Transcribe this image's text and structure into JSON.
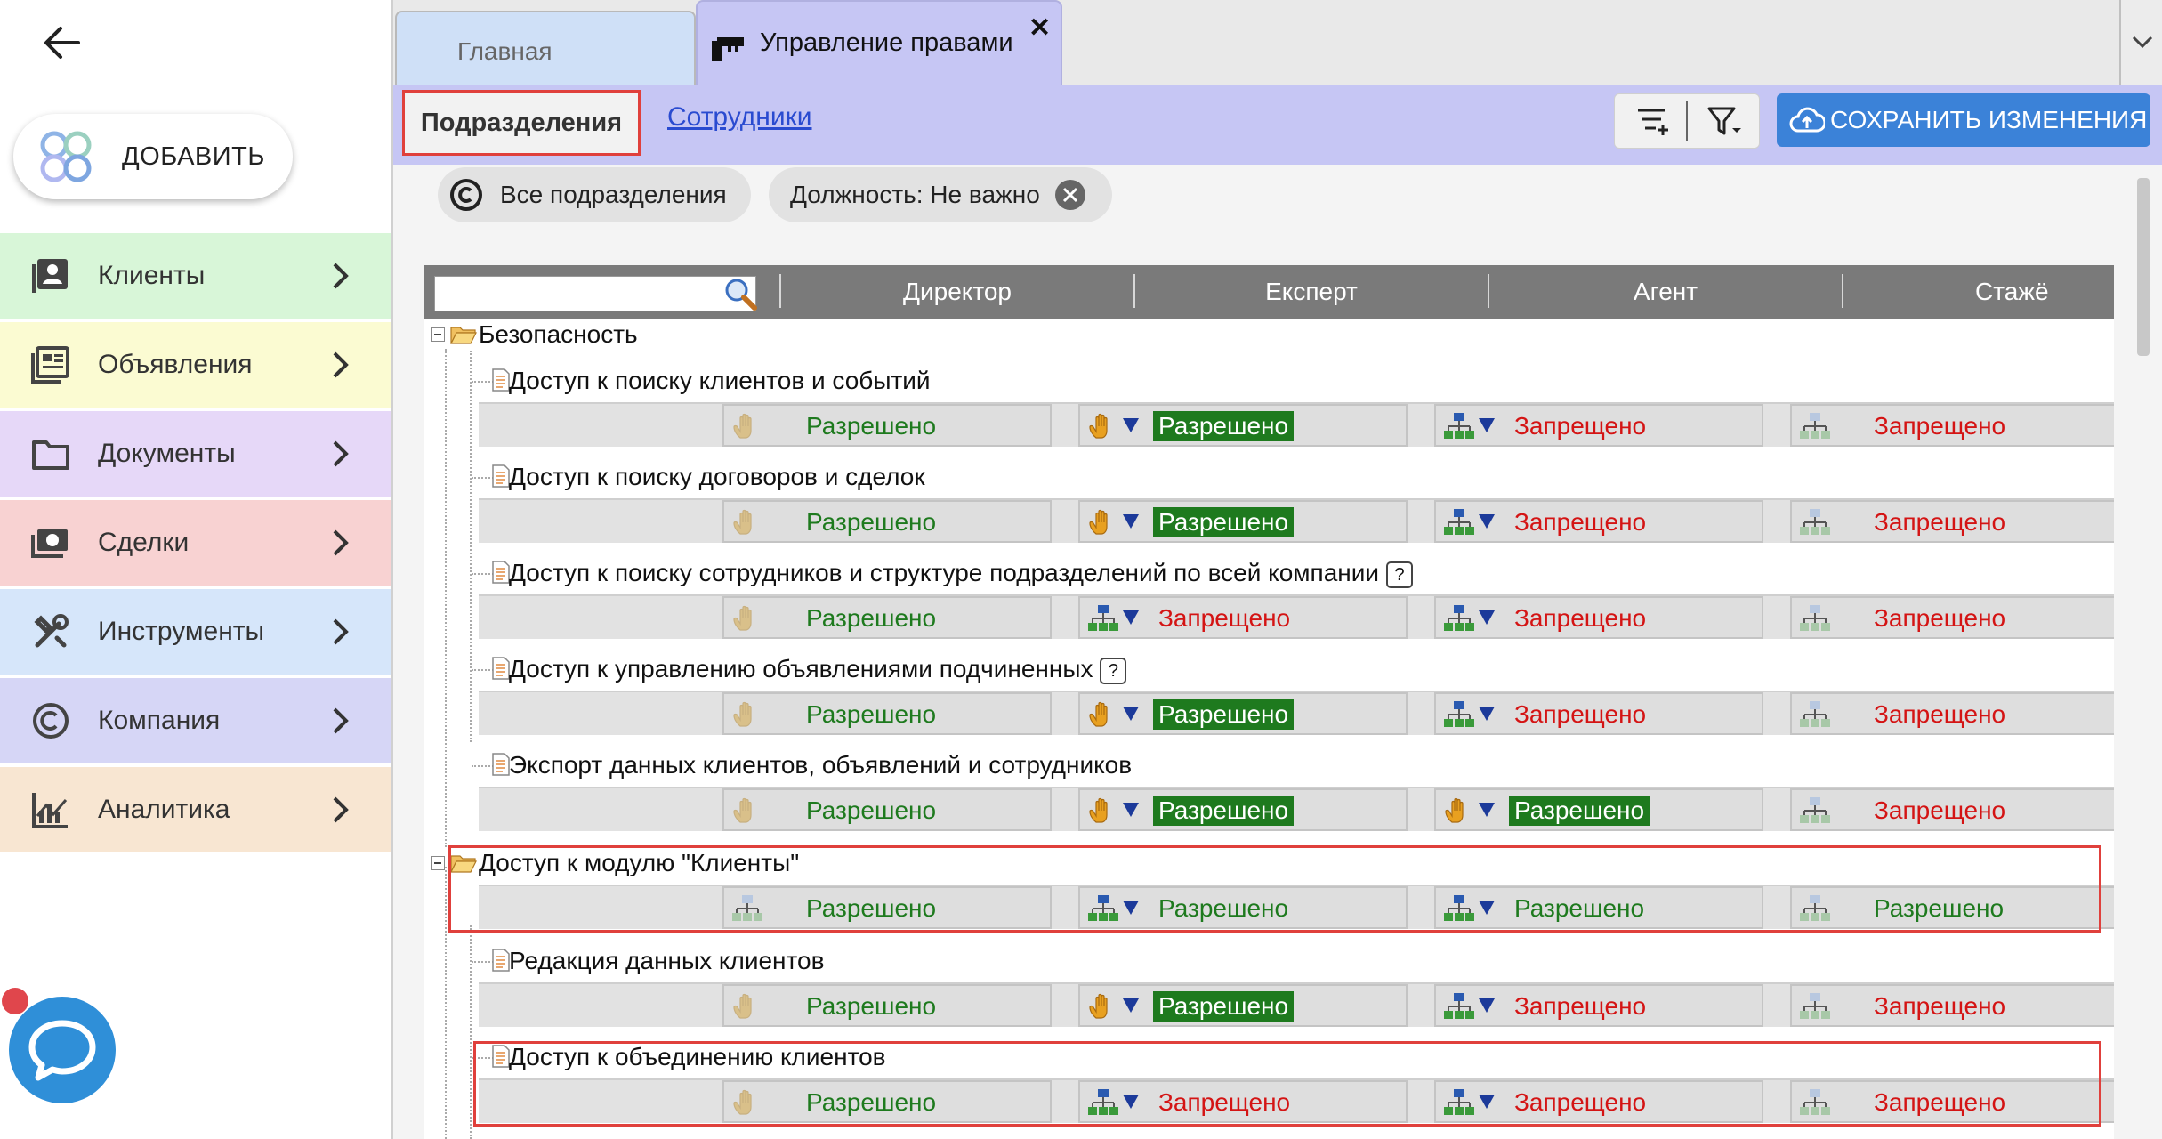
{
  "sidebar": {
    "add_label": "ДОБАВИТЬ",
    "items": [
      {
        "label": "Клиенты",
        "color": "#d8f6d8",
        "icon": "contacts-icon"
      },
      {
        "label": "Объявления",
        "color": "#fbfbd2",
        "icon": "listings-icon"
      },
      {
        "label": "Документы",
        "color": "#e6d8f8",
        "icon": "folder-icon"
      },
      {
        "label": "Сделки",
        "color": "#f8d2d2",
        "icon": "deal-icon"
      },
      {
        "label": "Инструменты",
        "color": "#d6e6fa",
        "icon": "tools-icon"
      },
      {
        "label": "Компания",
        "color": "#d6d6f6",
        "icon": "copyright-icon"
      },
      {
        "label": "Аналитика",
        "color": "#f8e6d2",
        "icon": "analytics-icon"
      }
    ]
  },
  "tabs": {
    "home": "Главная",
    "rights": "Управление правами",
    "close": "✕"
  },
  "toolbar": {
    "subtab_divisions": "Подразделения",
    "subtab_employees": "Сотрудники",
    "save_label": "СОХРАНИТЬ ИЗМЕНЕНИЯ"
  },
  "filters": {
    "all_divisions": "Все подразделения",
    "position": "Должность: Не важно"
  },
  "grid": {
    "columns": [
      "Директор",
      "Експерт",
      "Агент",
      "Стажё"
    ],
    "rows": [
      {
        "label": "Безопасность",
        "type": "group"
      },
      {
        "label": "Доступ к поиску клиентов и событий",
        "type": "item",
        "help": false,
        "cells": [
          [
            "hand-gray",
            "Разрешено",
            "green"
          ],
          [
            "hand",
            "Разрешено",
            "greenbg"
          ],
          [
            "org",
            "Запрещено",
            "red"
          ],
          [
            "org-gray",
            "Запрещено",
            "red"
          ]
        ]
      },
      {
        "label": "Доступ к поиску договоров и сделок",
        "type": "item",
        "help": false,
        "cells": [
          [
            "hand-gray",
            "Разрешено",
            "green"
          ],
          [
            "hand",
            "Разрешено",
            "greenbg"
          ],
          [
            "org",
            "Запрещено",
            "red"
          ],
          [
            "org-gray",
            "Запрещено",
            "red"
          ]
        ]
      },
      {
        "label": "Доступ к поиску сотрудников и структуре подразделений по всей компании",
        "type": "item",
        "help": true,
        "cells": [
          [
            "hand-gray",
            "Разрешено",
            "green"
          ],
          [
            "org",
            "Запрещено",
            "red"
          ],
          [
            "org",
            "Запрещено",
            "red"
          ],
          [
            "org-gray",
            "Запрещено",
            "red"
          ]
        ]
      },
      {
        "label": "Доступ к управлению объявлениями подчиненных",
        "type": "item",
        "help": true,
        "cells": [
          [
            "hand-gray",
            "Разрешено",
            "green"
          ],
          [
            "hand",
            "Разрешено",
            "greenbg"
          ],
          [
            "org",
            "Запрещено",
            "red"
          ],
          [
            "org-gray",
            "Запрещено",
            "red"
          ]
        ]
      },
      {
        "label": "Экспорт данных клиентов, объявлений и сотрудников",
        "type": "item",
        "help": false,
        "cells": [
          [
            "hand-gray",
            "Разрешено",
            "green"
          ],
          [
            "hand",
            "Разрешено",
            "greenbg"
          ],
          [
            "hand",
            "Разрешено",
            "greenbg"
          ],
          [
            "org-gray",
            "Запрещено",
            "red"
          ]
        ]
      },
      {
        "label": "Доступ к модулю \"Клиенты\"",
        "type": "group",
        "cells": [
          [
            "org-gray",
            "Разрешено",
            "green"
          ],
          [
            "org",
            "Разрешено",
            "green"
          ],
          [
            "org",
            "Разрешено",
            "green"
          ],
          [
            "org-gray",
            "Разрешено",
            "green"
          ]
        ]
      },
      {
        "label": "Редакция данных клиентов",
        "type": "item",
        "help": false,
        "cells": [
          [
            "hand-gray",
            "Разрешено",
            "green"
          ],
          [
            "hand",
            "Разрешено",
            "greenbg"
          ],
          [
            "org",
            "Запрещено",
            "red"
          ],
          [
            "org-gray",
            "Запрещено",
            "red"
          ]
        ]
      },
      {
        "label": "Доступ к объединению клиентов",
        "type": "item",
        "help": false,
        "cells": [
          [
            "hand-gray",
            "Разрешено",
            "green"
          ],
          [
            "org",
            "Запрещено",
            "red"
          ],
          [
            "org",
            "Запрещено",
            "red"
          ],
          [
            "org-gray",
            "Запрещено",
            "red"
          ]
        ]
      }
    ]
  }
}
